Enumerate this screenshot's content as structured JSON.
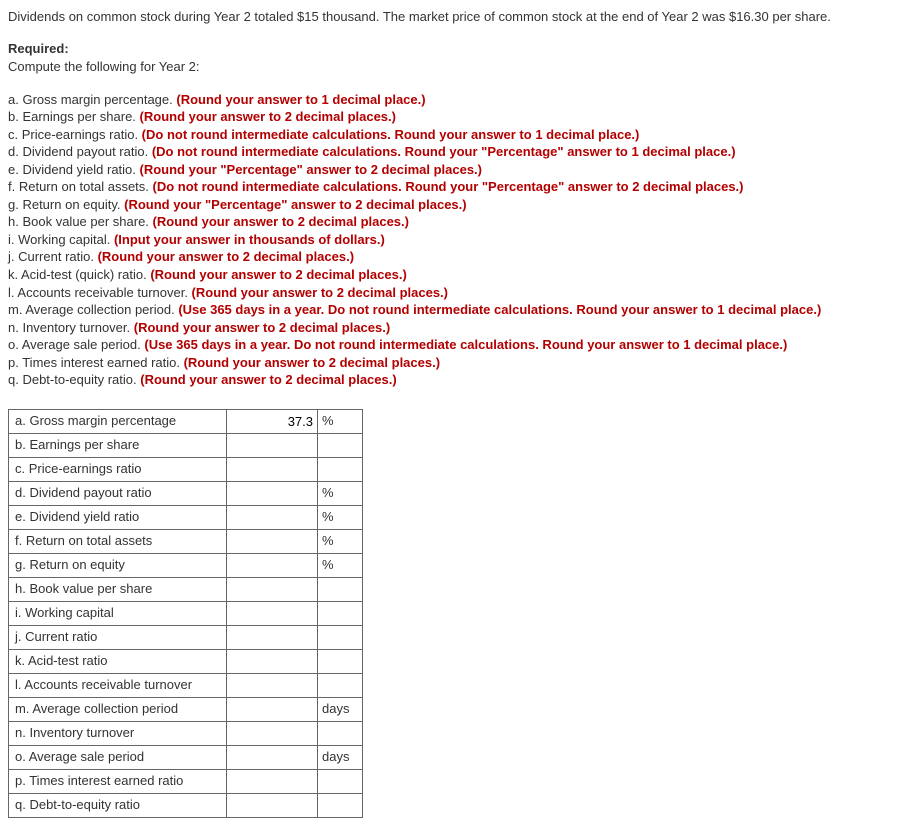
{
  "intro": "Dividends on common stock during Year 2 totaled $15 thousand. The market price of common stock at the end of Year 2 was $16.30 per share.",
  "required_label": "Required:",
  "compute_text": "Compute the following for Year 2:",
  "items": [
    {
      "letter": "a.",
      "text": "Gross margin percentage.",
      "hint": "(Round your answer to 1 decimal place.)"
    },
    {
      "letter": "b.",
      "text": "Earnings per share.",
      "hint": "(Round your answer to 2 decimal places.)"
    },
    {
      "letter": "c.",
      "text": "Price-earnings ratio.",
      "hint": "(Do not round intermediate calculations. Round your answer to 1 decimal place.)"
    },
    {
      "letter": "d.",
      "text": "Dividend payout ratio.",
      "hint": "(Do not round intermediate calculations. Round your \"Percentage\" answer to 1 decimal place.)"
    },
    {
      "letter": "e.",
      "text": "Dividend yield ratio.",
      "hint": "(Round your \"Percentage\" answer to 2 decimal places.)"
    },
    {
      "letter": "f.",
      "text": "Return on total assets.",
      "hint": "(Do not round intermediate calculations. Round your \"Percentage\" answer to 2 decimal places.)"
    },
    {
      "letter": "g.",
      "text": "Return on equity.",
      "hint": "(Round your \"Percentage\" answer to 2 decimal places.)"
    },
    {
      "letter": "h.",
      "text": "Book value per share.",
      "hint": "(Round your answer to 2 decimal places.)"
    },
    {
      "letter": "i.",
      "text": "Working capital.",
      "hint": "(Input your answer in thousands of dollars.)"
    },
    {
      "letter": "j.",
      "text": "Current ratio.",
      "hint": "(Round your answer to 2 decimal places.)"
    },
    {
      "letter": "k.",
      "text": "Acid-test (quick) ratio.",
      "hint": "(Round your answer to 2 decimal places.)"
    },
    {
      "letter": "l.",
      "text": "Accounts receivable turnover.",
      "hint": "(Round your answer to 2 decimal places.)"
    },
    {
      "letter": "m.",
      "text": "Average collection period.",
      "hint": "(Use 365 days in a year. Do not round intermediate calculations. Round your answer to 1 decimal place.)"
    },
    {
      "letter": "n.",
      "text": "Inventory turnover.",
      "hint": "(Round your answer to 2 decimal places.)"
    },
    {
      "letter": "o.",
      "text": "Average sale period.",
      "hint": "(Use 365 days in a year. Do not round intermediate calculations. Round your answer to 1 decimal place.)"
    },
    {
      "letter": "p.",
      "text": "Times interest earned ratio.",
      "hint": "(Round your answer to 2 decimal places.)"
    },
    {
      "letter": "q.",
      "text": "Debt-to-equity ratio.",
      "hint": "(Round your answer to 2 decimal places.)"
    }
  ],
  "table_rows": [
    {
      "label": "a. Gross margin percentage",
      "value": "37.3",
      "unit": "%"
    },
    {
      "label": "b. Earnings per share",
      "value": "",
      "unit": ""
    },
    {
      "label": "c. Price-earnings ratio",
      "value": "",
      "unit": ""
    },
    {
      "label": "d. Dividend payout ratio",
      "value": "",
      "unit": "%"
    },
    {
      "label": "e. Dividend yield ratio",
      "value": "",
      "unit": "%"
    },
    {
      "label": "f. Return on total assets",
      "value": "",
      "unit": "%"
    },
    {
      "label": "g. Return on equity",
      "value": "",
      "unit": "%"
    },
    {
      "label": "h. Book value per share",
      "value": "",
      "unit": ""
    },
    {
      "label": "i. Working capital",
      "value": "",
      "unit": ""
    },
    {
      "label": "j. Current ratio",
      "value": "",
      "unit": ""
    },
    {
      "label": "k. Acid-test ratio",
      "value": "",
      "unit": ""
    },
    {
      "label": "l. Accounts receivable turnover",
      "value": "",
      "unit": ""
    },
    {
      "label": "m. Average collection period",
      "value": "",
      "unit": "days"
    },
    {
      "label": "n. Inventory turnover",
      "value": "",
      "unit": ""
    },
    {
      "label": "o. Average sale period",
      "value": "",
      "unit": "days"
    },
    {
      "label": "p. Times interest earned ratio",
      "value": "",
      "unit": ""
    },
    {
      "label": "q. Debt-to-equity ratio",
      "value": "",
      "unit": ""
    }
  ]
}
